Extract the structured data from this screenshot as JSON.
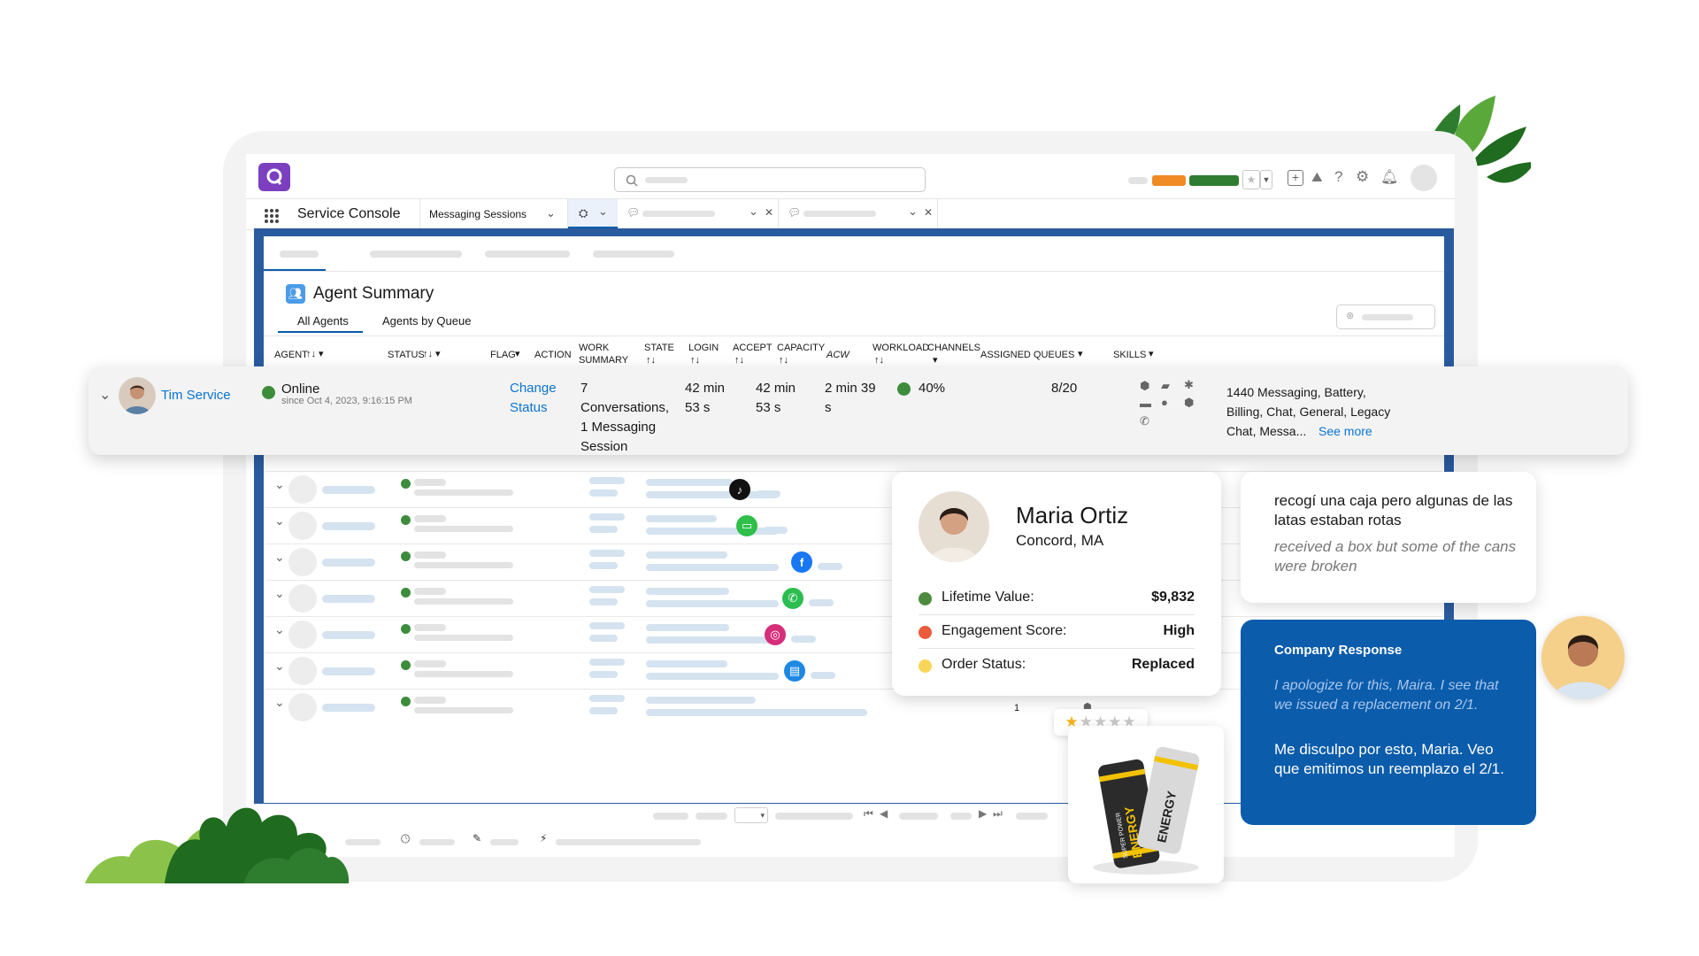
{
  "app": {
    "name": "Service Console"
  },
  "tabs": [
    {
      "label": "Messaging Sessions"
    }
  ],
  "page": {
    "title": "Agent Summary",
    "subtabs": [
      "All Agents",
      "Agents by Queue"
    ]
  },
  "columns": [
    "AGENT",
    "STATUS",
    "FLAG",
    "ACTION",
    "WORK SUMMARY",
    "STATE",
    "LOGIN",
    "ACCEPT",
    "CAPACITY",
    "ACW",
    "WORKLOAD",
    "CHANNELS",
    "ASSIGNED QUEUES",
    "SKILLS"
  ],
  "column_work_summary": [
    "WORK",
    "SUMMARY"
  ],
  "highlighted_row": {
    "agent": "Tim Service",
    "status": "Online",
    "since": "since Oct 4, 2023, 9:16:15 PM",
    "action": "Change Status",
    "action_line1": "Change",
    "action_line2": "Status",
    "work_summary": [
      "7",
      "Conversations,",
      "1 Messaging",
      "Session"
    ],
    "state": [
      "42 min",
      "53 s"
    ],
    "login": [
      "42 min",
      "53 s"
    ],
    "accept": [
      "2 min 39",
      "s"
    ],
    "capacity": "40%",
    "workload": "8/20",
    "queues": [
      "1440 Messaging, Battery,",
      "Billing, Chat, General, Legacy",
      "Chat, Messa..."
    ],
    "see_more": "See more"
  },
  "footer_value": "1",
  "customer": {
    "name": "Maria Ortiz",
    "location": "Concord, MA",
    "fields": [
      {
        "label": "Lifetime Value:",
        "value": "$9,832",
        "color": "#4e8a3e"
      },
      {
        "label": "Engagement Score:",
        "value": "High",
        "color": "#ea5b3c"
      },
      {
        "label": "Order Status:",
        "value": "Replaced",
        "color": "#f7d55a"
      }
    ]
  },
  "message_in": {
    "original": "recogí una caja pero algunas de las latas estaban rotas",
    "translation": "received a box but some of the cans were broken"
  },
  "message_out": {
    "title": "Company Response",
    "translation": "I apologize for this, Maira. I see that we issued a replacement on 2/1.",
    "original": "Me disculpo por esto, Maria. Veo que emitimos un reemplazo el 2/1."
  },
  "rating": {
    "stars": 1,
    "out_of": 5
  },
  "product": {
    "brand_text": "ENERGY",
    "sub_text": "SUPER POWER"
  },
  "colors": {
    "accent": "#0b5cab",
    "online": "#3c8c3c",
    "brand": "#7b3fbf",
    "workspace": "#2a5b9e"
  }
}
